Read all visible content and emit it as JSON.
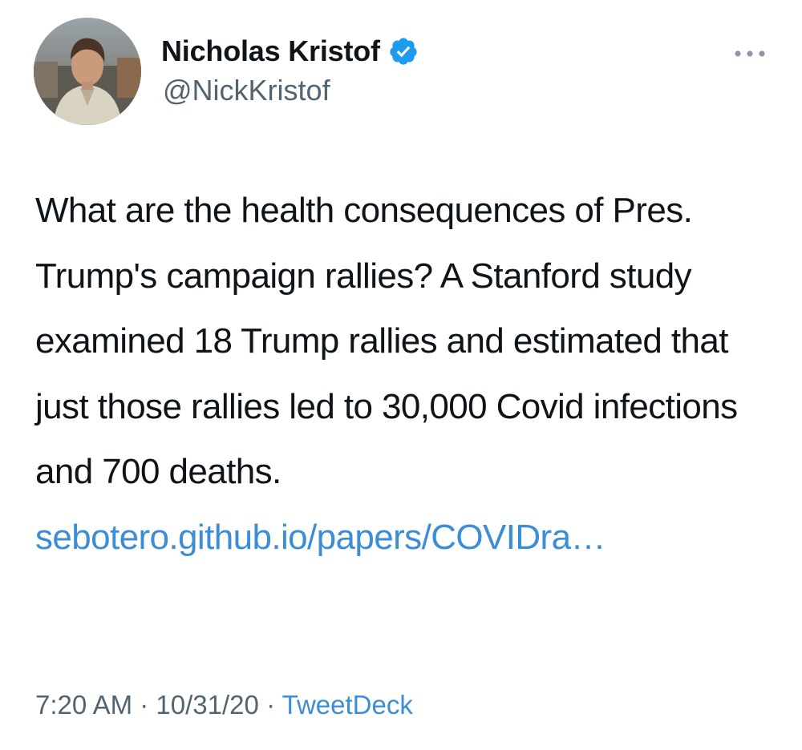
{
  "author": {
    "display_name": "Nicholas Kristof",
    "handle": "@NickKristof",
    "verified": true,
    "avatar_icon": "profile-photo"
  },
  "menu_icon": "more-horizontal-icon",
  "tweet": {
    "text": "What are the health consequences of Pres. Trump's campaign rallies? A Stanford study examined 18 Trump rallies and estimated that just those rallies led to 30,000 Covid infections and 700 deaths.",
    "link_text": "sebotero.github.io/papers/COVIDra…"
  },
  "meta": {
    "time": "7:20 AM",
    "separator": "·",
    "date": "10/31/20",
    "source": "TweetDeck"
  },
  "colors": {
    "link": "#3b8ed6",
    "verified_badge": "#1d9bf0",
    "secondary_text": "#536471",
    "primary_text": "#0f1419"
  }
}
